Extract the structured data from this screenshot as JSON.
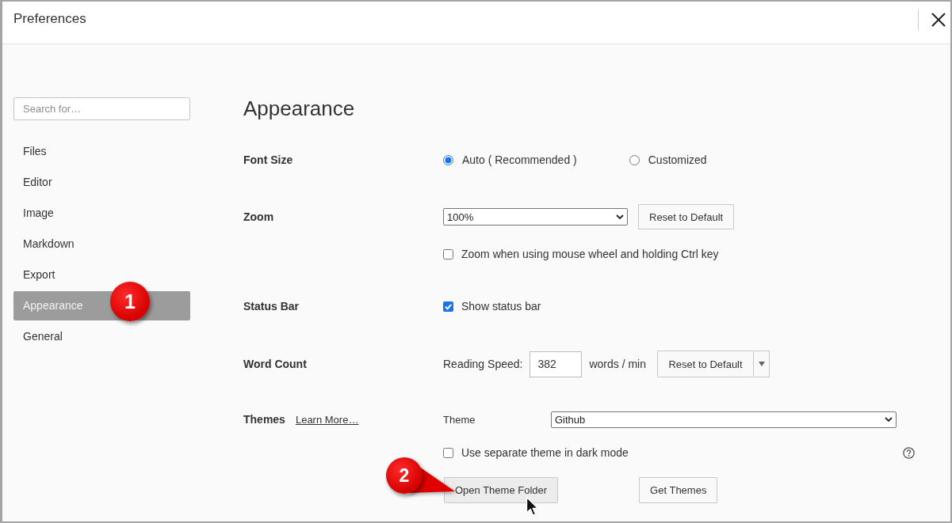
{
  "window": {
    "title": "Preferences"
  },
  "sidebar": {
    "search": {
      "placeholder": "Search for…"
    },
    "items": [
      {
        "label": "Files",
        "selected": false
      },
      {
        "label": "Editor",
        "selected": false
      },
      {
        "label": "Image",
        "selected": false
      },
      {
        "label": "Markdown",
        "selected": false
      },
      {
        "label": "Export",
        "selected": false
      },
      {
        "label": "Appearance",
        "selected": true,
        "callout": {
          "label": "1",
          "pointer": false
        }
      },
      {
        "label": "General",
        "selected": false
      }
    ]
  },
  "page": {
    "heading": "Appearance",
    "sections": [
      {
        "label": "Font Size",
        "controls": [
          {
            "kind": "radio_group",
            "options": [
              {
                "label": "Auto ( Recommended )",
                "selected": true
              },
              {
                "label": "Customized",
                "selected": false
              }
            ]
          }
        ]
      },
      {
        "label": "Zoom",
        "controls": [
          {
            "kind": "select_with_button",
            "value": "100%",
            "button": "Reset to Default"
          },
          {
            "kind": "checkbox",
            "label": "Zoom when using mouse wheel and holding Ctrl key",
            "checked": false
          }
        ]
      },
      {
        "label": "Status Bar",
        "controls": [
          {
            "kind": "checkbox",
            "label": "Show status bar",
            "checked": true
          }
        ]
      },
      {
        "label": "Word Count",
        "controls": [
          {
            "kind": "number_field",
            "label": "Reading Speed:",
            "value": "382",
            "unit": "words / min",
            "button": "Reset to Default"
          }
        ]
      },
      {
        "label": "Themes",
        "link": "Learn More…",
        "controls": [
          {
            "kind": "labeled_select",
            "label": "Theme",
            "value": "Github"
          },
          {
            "kind": "checkbox",
            "label": "Use separate theme in dark mode",
            "checked": false,
            "help": true
          },
          {
            "kind": "button_row",
            "buttons": [
              {
                "label": "Open Theme Folder",
                "hovered": true,
                "callout": {
                  "label": "2",
                  "pointer": true
                }
              },
              {
                "label": "Get Themes",
                "hovered": false
              }
            ]
          }
        ]
      }
    ]
  }
}
